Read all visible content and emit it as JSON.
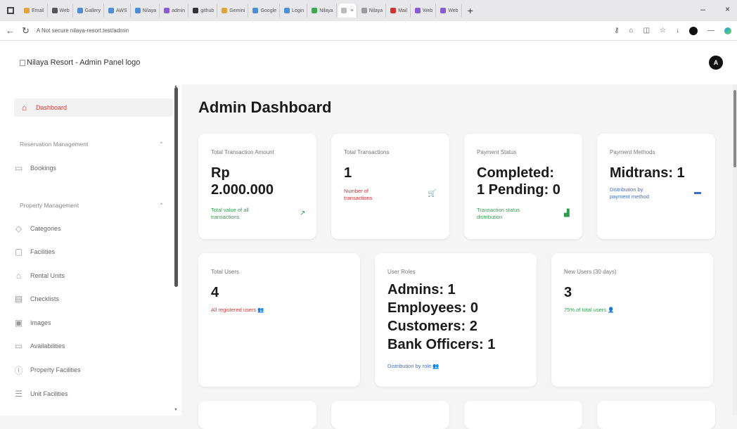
{
  "browser": {
    "tabs": [
      "Email",
      "Web",
      "Gallery",
      "AWS",
      "Nilaya",
      "admin",
      "github",
      "Gemini",
      "Google",
      "Login",
      "Nilaya",
      "",
      "Nilaya",
      "Mail",
      "Web",
      "Web"
    ],
    "active_tab_index": 11,
    "new_tab": "+",
    "url": "A Not secure   nilaya-resort.test/admin",
    "window_controls": [
      "–",
      "×"
    ]
  },
  "header": {
    "logo_alt": "Nilaya Resort - Admin Panel logo",
    "avatar_initial": "A"
  },
  "sidebar": {
    "dashboard": "Dashboard",
    "groups": {
      "reservation": "Reservation Management",
      "property": "Property Management"
    },
    "items": {
      "bookings": "Bookings",
      "categories": "Categories",
      "facilities": "Facilities",
      "rental_units": "Rental Units",
      "checklists": "Checklists",
      "images": "Images",
      "availabilities": "Availabilities",
      "property_facilities": "Property Facilities",
      "unit_facilities": "Unit Facilities"
    }
  },
  "main": {
    "title": "Admin Dashboard",
    "cards": {
      "total_amount": {
        "label": "Total Transaction Amount",
        "value1": "Rp",
        "value2": "2.000.000",
        "desc1": "Total value of all",
        "desc2": "transactions"
      },
      "total_transactions": {
        "label": "Total Transactions",
        "value": "1",
        "desc1": "Number of",
        "desc2": "transactions"
      },
      "payment_status": {
        "label": "Payment Status",
        "value1": "Completed:",
        "value2": "1 Pending: 0",
        "desc1": "Transaction status",
        "desc2": "distribution"
      },
      "payment_methods": {
        "label": "Payment Methods",
        "value": "Midtrans: 1",
        "desc1": "Distribution by",
        "desc2": "payment method"
      },
      "total_users": {
        "label": "Total Users",
        "value": "4",
        "desc": "All registered users"
      },
      "user_roles": {
        "label": "User Roles",
        "line1": "Admins: 1",
        "line2": "Employees: 0",
        "line3": "Customers: 2",
        "line4": "Bank Officers: 1",
        "desc": "Distribution by role"
      },
      "new_users": {
        "label": "New Users (30 days)",
        "value": "3",
        "desc": "75% of total users"
      }
    }
  },
  "colors": {
    "accent_red": "#d43232",
    "accent_green": "#2e9d4a",
    "accent_blue": "#3b6fd1"
  }
}
